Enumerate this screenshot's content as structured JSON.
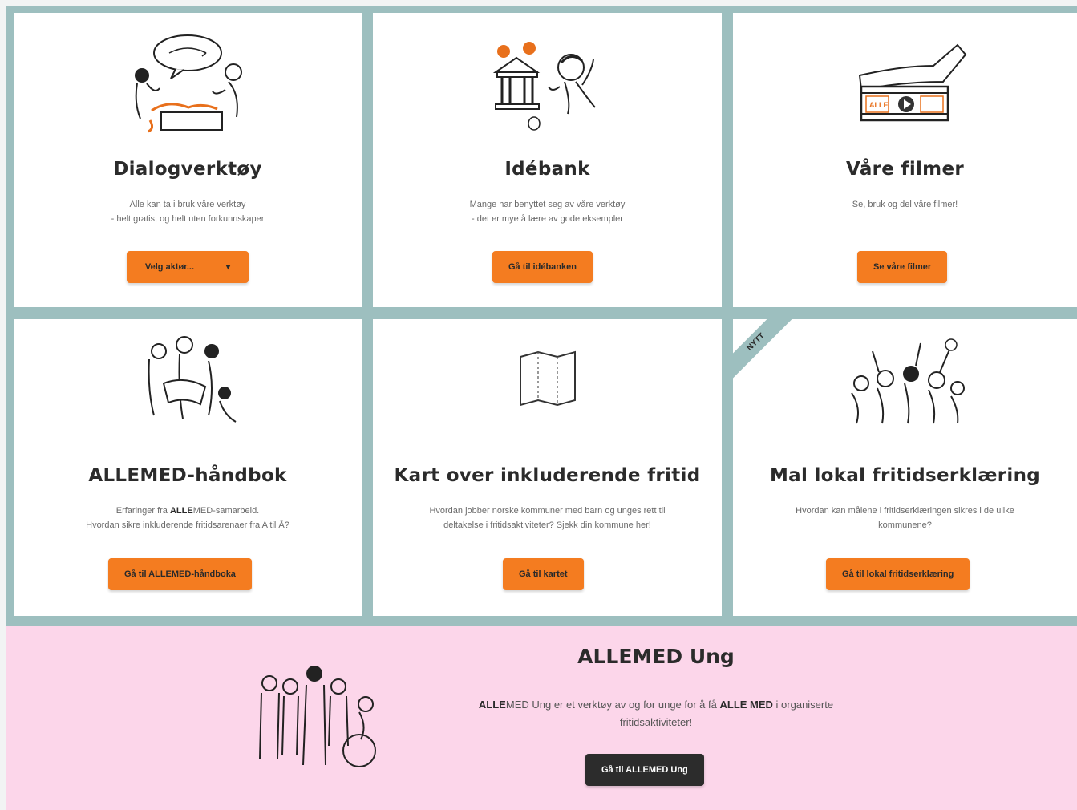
{
  "cards": [
    {
      "title": "Dialogverktøy",
      "desc_line1": "Alle kan ta i bruk våre verktøy",
      "desc_line2": "- helt gratis, og helt uten forkunnskaper",
      "select_label": "Velg aktør...",
      "chevron": "chevron-down-icon"
    },
    {
      "title": "Idébank",
      "desc_line1": "Mange har benyttet seg av våre verktøy",
      "desc_line2": "- det er mye å lære av gode eksempler",
      "button_label": "Gå til idébanken"
    },
    {
      "title": "Våre filmer",
      "desc_line1": "Se, bruk og del våre filmer!",
      "button_label": "Se våre filmer",
      "film_text": "ALLE"
    },
    {
      "title": "ALLEMED-håndbok",
      "desc_pre": "Erfaringer fra ",
      "desc_bold": "ALLE",
      "desc_post": "MED-samarbeid.",
      "desc_line2": "Hvordan sikre inkluderende fritidsarenaer fra A til Å?",
      "button_label": "Gå til ALLEMED-håndboka"
    },
    {
      "title": "Kart over inkluderende fritid",
      "desc_line1": "Hvordan jobber norske kommuner med barn og unges rett til",
      "desc_line2": "deltakelse i fritidsaktiviteter? Sjekk din kommune her!",
      "button_label": "Gå til kartet"
    },
    {
      "title": "Mal lokal fritidserklæring",
      "ribbon": "NYTT",
      "desc_line1": "Hvordan kan målene i fritidserklæringen sikres i de ulike",
      "desc_line2": "kommunene?",
      "button_label": "Gå til lokal fritidserklæring"
    }
  ],
  "banner": {
    "title": "ALLEMED Ung",
    "desc_b1": "ALLE",
    "desc_t1": "MED Ung er et verktøy av og for unge for å få ",
    "desc_b2": "ALLE MED",
    "desc_t2": " i organiserte fritidsaktiviteter!",
    "button_label": "Gå til ALLEMED Ung"
  },
  "colors": {
    "accent": "#f47c20",
    "frame": "#9dbfbf",
    "banner_bg": "#fcd6ea",
    "dark_button": "#2c2c2c"
  }
}
